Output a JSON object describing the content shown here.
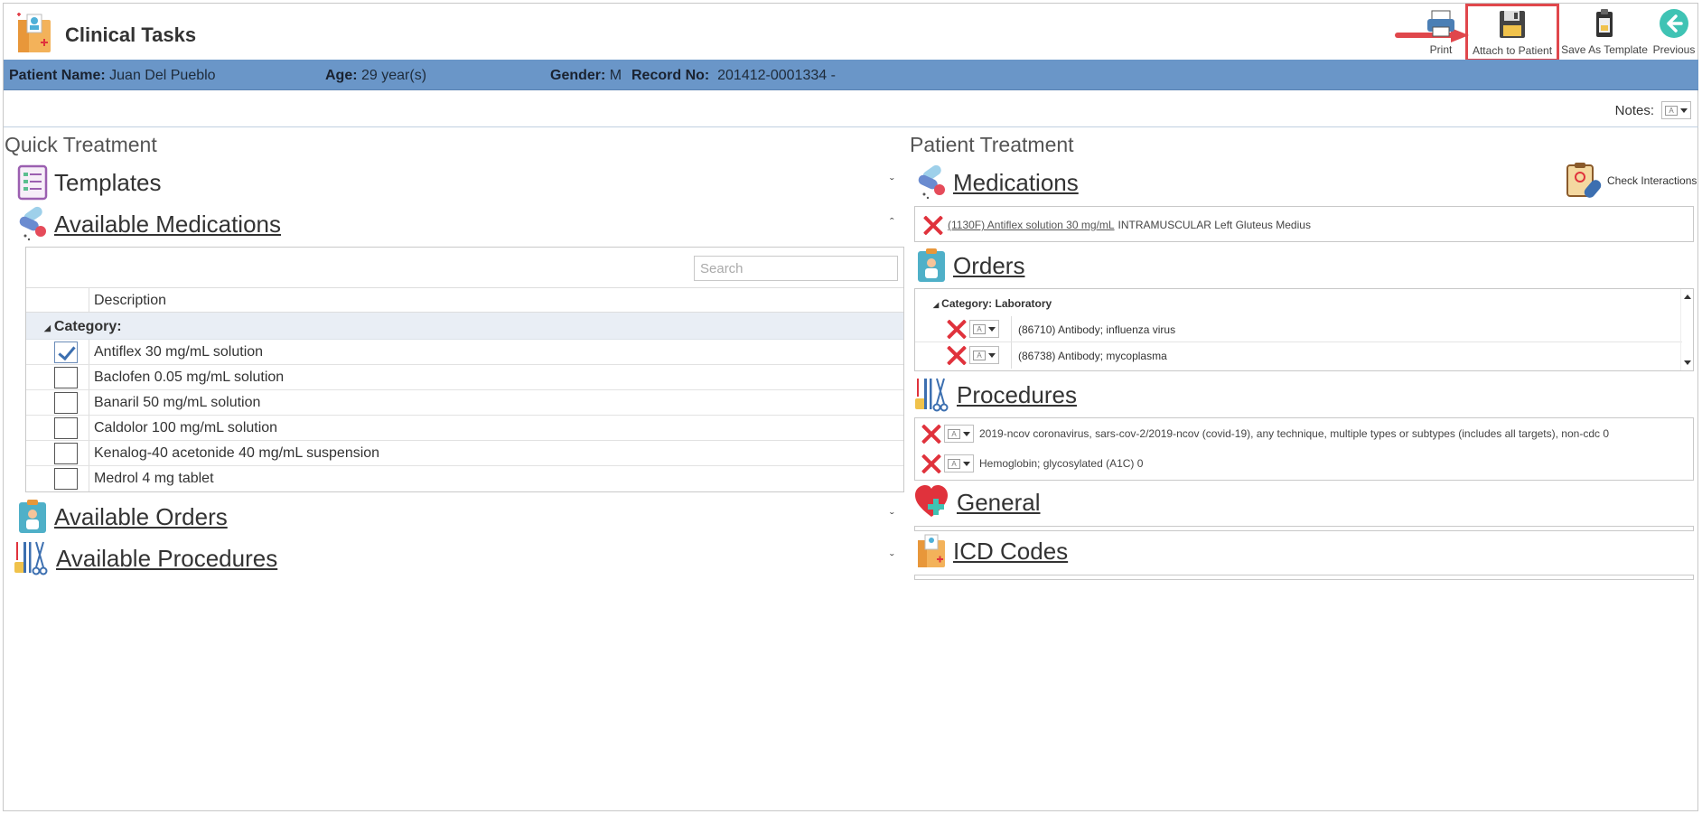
{
  "app": {
    "title": "Clinical Tasks"
  },
  "toolbar": {
    "print": "Print",
    "attach": "Attach to Patient",
    "save_template": "Save As Template",
    "previous": "Previous"
  },
  "patient": {
    "name_label": "Patient Name:",
    "name": "Juan Del Pueblo",
    "age_label": "Age:",
    "age": "29 year(s)",
    "gender_label": "Gender:",
    "gender": "M",
    "record_label": "Record No:",
    "record": "201412-0001334 -"
  },
  "notes": {
    "label": "Notes:"
  },
  "quick_treatment": {
    "title": "Quick Treatment",
    "templates": "Templates",
    "available_medications": "Available Medications",
    "search_placeholder": "Search",
    "column_description": "Description",
    "category_label": "Category:",
    "medications": [
      {
        "name": "Antiflex 30 mg/mL solution",
        "checked": true
      },
      {
        "name": "Baclofen 0.05 mg/mL solution",
        "checked": false
      },
      {
        "name": "Banaril 50 mg/mL solution",
        "checked": false
      },
      {
        "name": "Caldolor 100 mg/mL solution",
        "checked": false
      },
      {
        "name": "Kenalog-40 acetonide 40 mg/mL suspension",
        "checked": false
      },
      {
        "name": "Medrol 4 mg tablet",
        "checked": false
      }
    ],
    "available_orders": "Available Orders",
    "available_procedures": "Available Procedures"
  },
  "patient_treatment": {
    "title": "Patient Treatment",
    "medications_title": "Medications",
    "check_interactions": "Check Interactions",
    "medication_link": "(1130F) Antiflex solution 30 mg/mL",
    "medication_detail": "INTRAMUSCULAR Left Gluteus Medius",
    "orders_title": "Orders",
    "orders_category": "Category: Laboratory",
    "orders": [
      "(86710) Antibody; influenza virus",
      "(86738) Antibody; mycoplasma"
    ],
    "procedures_title": "Procedures",
    "procedures": [
      "2019-ncov coronavirus, sars-cov-2/2019-ncov (covid-19), any technique, multiple types or subtypes (includes all targets), non-cdc 0",
      "Hemoglobin; glycosylated (A1C) 0"
    ],
    "general_title": "General",
    "icd_title": "ICD Codes"
  },
  "colors": {
    "patient_bar": "#6a96c8",
    "highlight": "#e0474c",
    "remove": "#e0323c"
  }
}
